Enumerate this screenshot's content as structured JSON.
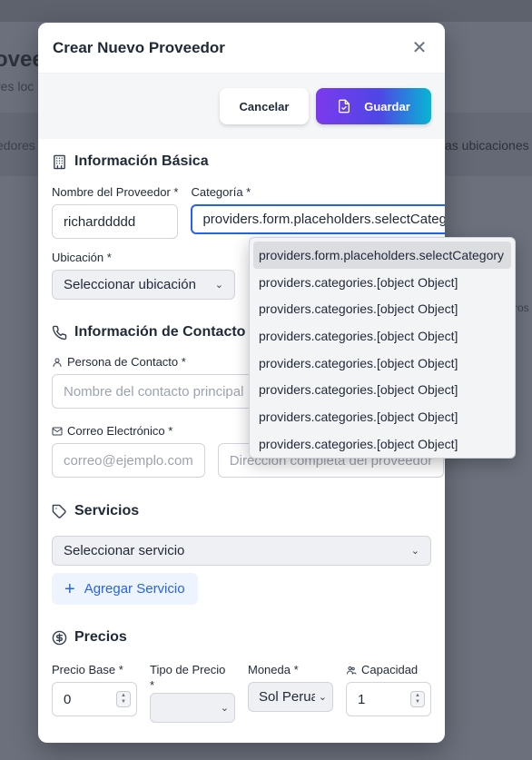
{
  "background": {
    "title": "oveedores",
    "subtitle": "res loc",
    "tab_left": "edores",
    "tab_right": "as ubicaciones",
    "right_text": "ros"
  },
  "modal": {
    "title": "Crear Nuevo Proveedor",
    "close_icon": "close-icon",
    "cancel_label": "Cancelar",
    "save_label": "Guardar"
  },
  "basic_info": {
    "title": "Información Básica",
    "provider_name_label": "Nombre del Proveedor *",
    "provider_name_value": "richarddddd",
    "category_label": "Categoría *",
    "category_value": "providers.form.placeholders.selectCategory",
    "location_label": "Ubicación *",
    "location_value": "Seleccionar ubicación"
  },
  "contact_info": {
    "title": "Información de Contacto",
    "contact_person_label": "Persona de Contacto *",
    "contact_person_placeholder": "Nombre del contacto principal",
    "email_label": "Correo Electrónico *",
    "email_placeholder": "correo@ejemplo.com",
    "address_placeholder": "Dirección completa del proveedor"
  },
  "services": {
    "title": "Servicios",
    "select_value": "Seleccionar servicio",
    "add_label": "Agregar Servicio"
  },
  "prices": {
    "title": "Precios",
    "base_price_label": "Precio Base *",
    "base_price_value": "0",
    "price_type_label": "Tipo de Precio",
    "price_type_required": "*",
    "currency_label": "Moneda *",
    "currency_value": "Sol Peruano",
    "capacity_label": "Capacidad",
    "capacity_value": "1"
  },
  "category_dropdown": {
    "options": [
      "providers.form.placeholders.selectCategory",
      "providers.categories.[object Object]",
      "providers.categories.[object Object]",
      "providers.categories.[object Object]",
      "providers.categories.[object Object]",
      "providers.categories.[object Object]",
      "providers.categories.[object Object]",
      "providers.categories.[object Object]"
    ],
    "selected_index": 0
  },
  "colors": {
    "accent": "#2563eb",
    "save_gradient_start": "#7c3aed",
    "save_gradient_end": "#06b6d4"
  }
}
